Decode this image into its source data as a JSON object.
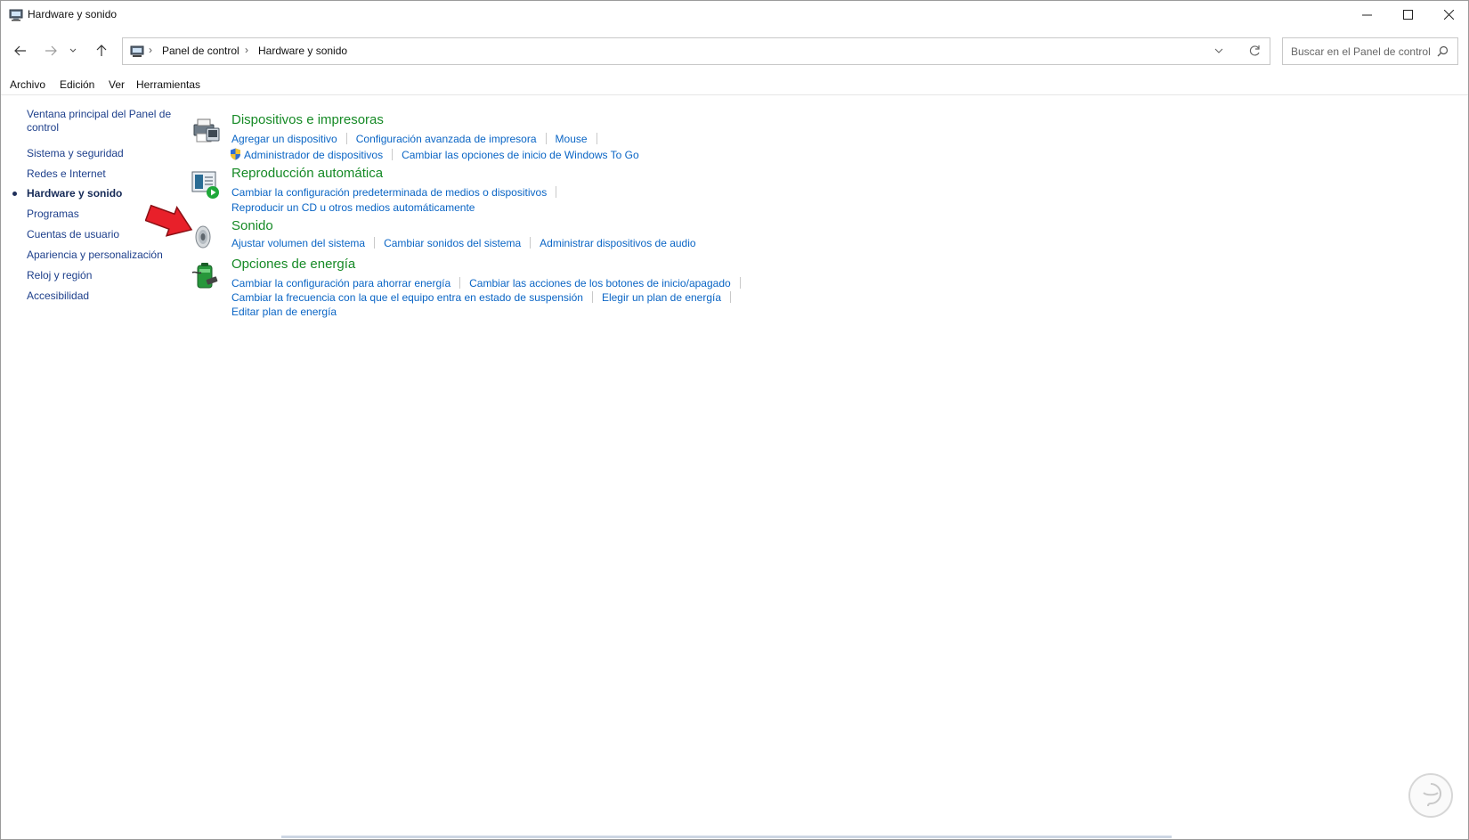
{
  "window": {
    "title": "Hardware y sonido"
  },
  "address_bar": {
    "crumbs": [
      "Panel de control",
      "Hardware y sonido"
    ],
    "separator": "›"
  },
  "search": {
    "placeholder": "Buscar en el Panel de control"
  },
  "menu": [
    "Archivo",
    "Edición",
    "Ver",
    "Herramientas"
  ],
  "sidebar": {
    "items": [
      {
        "label": "Ventana principal del Panel de control"
      },
      {
        "label": "Sistema y seguridad"
      },
      {
        "label": "Redes e Internet"
      },
      {
        "label": "Hardware y sonido",
        "active": true
      },
      {
        "label": "Programas"
      },
      {
        "label": "Cuentas de usuario"
      },
      {
        "label": "Apariencia y personalización"
      },
      {
        "label": "Reloj y región"
      },
      {
        "label": "Accesibilidad"
      }
    ]
  },
  "sections": [
    {
      "title": "Dispositivos e impresoras",
      "icon": "printer-device-icon",
      "rows": [
        [
          "Agregar un dispositivo",
          "Configuración avanzada de impresora",
          "Mouse"
        ],
        [
          "Administrador de dispositivos",
          "Cambiar las opciones de inicio de Windows To Go"
        ]
      ]
    },
    {
      "title": "Reproducción automática",
      "icon": "autoplay-icon",
      "rows": [
        [
          "Cambiar la configuración predeterminada de medios o dispositivos"
        ],
        [
          "Reproducir un CD u otros medios automáticamente"
        ]
      ]
    },
    {
      "title": "Sonido",
      "icon": "speaker-icon",
      "rows": [
        [
          "Ajustar volumen del sistema",
          "Cambiar sonidos del sistema",
          "Administrar dispositivos de audio"
        ]
      ]
    },
    {
      "title": "Opciones de energía",
      "icon": "battery-power-icon",
      "rows": [
        [
          "Cambiar la configuración para ahorrar energía",
          "Cambiar las acciones de los botones de inicio/apagado"
        ],
        [
          "Cambiar la frecuencia con la que el equipo entra en estado de suspensión",
          "Elegir un plan de energía"
        ],
        [
          "Editar plan de energía"
        ]
      ]
    }
  ],
  "colors": {
    "section_title": "#168a26",
    "link": "#0a65c5",
    "nav_link": "#1d3f8b",
    "annotation_arrow": "#e8202a"
  }
}
